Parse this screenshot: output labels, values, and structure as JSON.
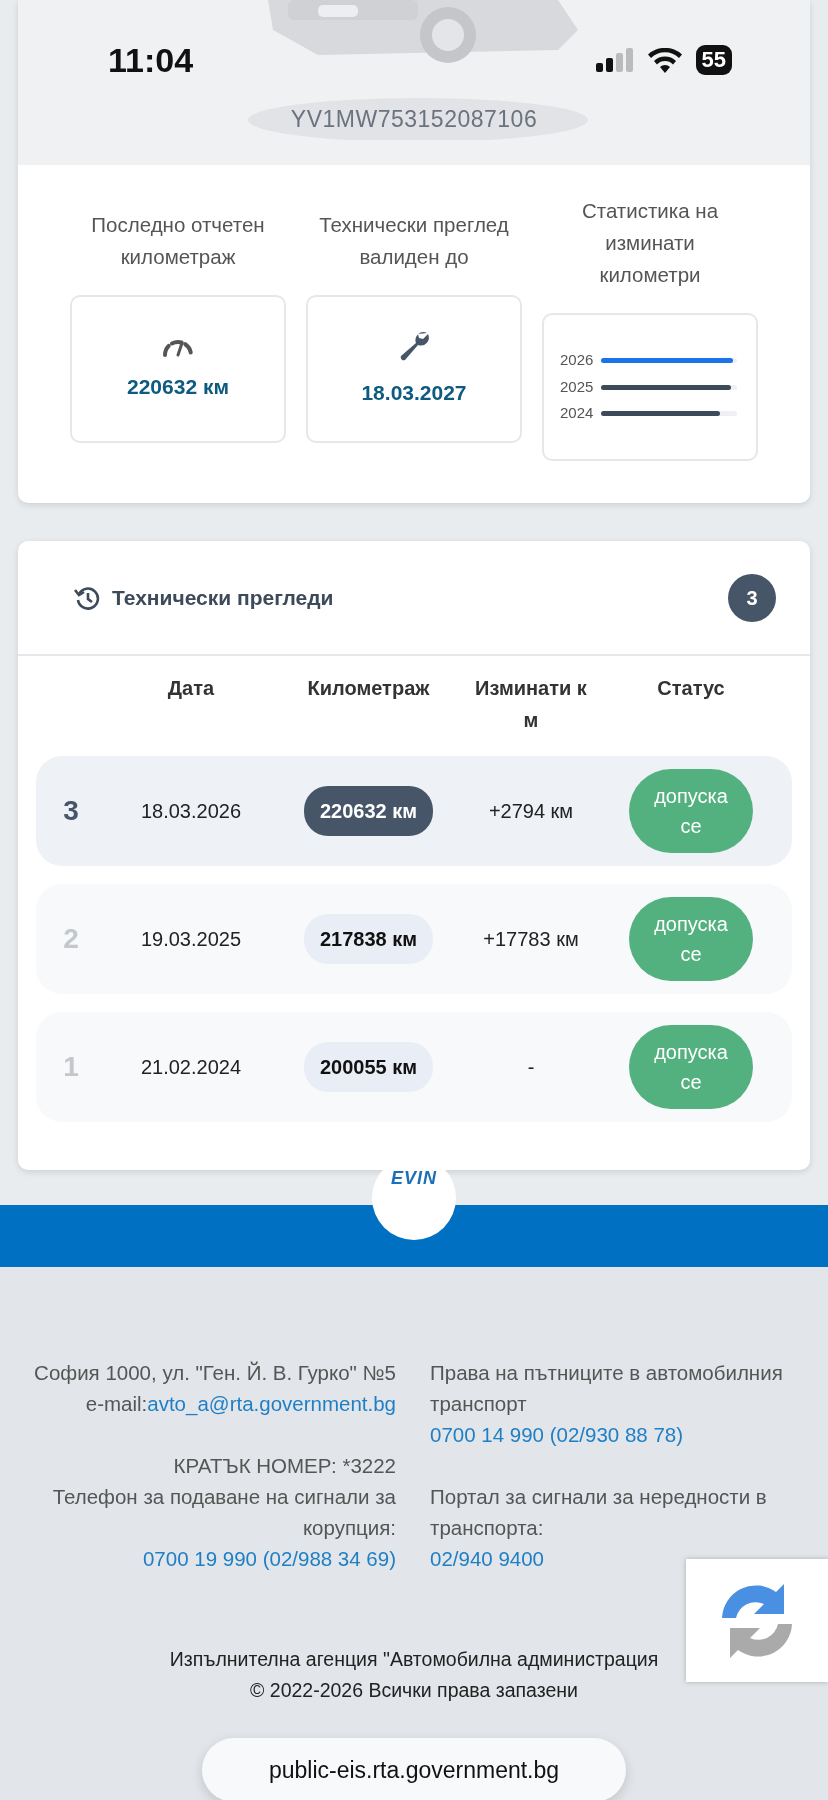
{
  "status_bar": {
    "time": "11:04",
    "battery": "55"
  },
  "vehicle": {
    "vin": "YV1MW753152087106"
  },
  "stats": [
    {
      "kind": "mileage",
      "label": "Последно отчетен километраж",
      "value": "220632 км"
    },
    {
      "kind": "inspection",
      "label": "Технически преглед валиден до",
      "value": "18.03.2027"
    },
    {
      "kind": "chart",
      "label": "Статистика на изминати километри",
      "years": [
        {
          "year": "2026",
          "color": "#1a73e8",
          "level": 0.97
        },
        {
          "year": "2025",
          "color": "#3d4a5a",
          "level": 0.95
        },
        {
          "year": "2024",
          "color": "#3d4a5a",
          "level": 0.87
        }
      ]
    }
  ],
  "inspections": {
    "title": "Технически прегледи",
    "count": "3",
    "columns": [
      "Дата",
      "Километраж",
      "Изминати км",
      "Статус"
    ],
    "rows": [
      {
        "index": "3",
        "date": "18.03.2026",
        "mileage": "220632 км",
        "diff": "+2794 км",
        "status": "допуска се",
        "selected": true
      },
      {
        "index": "2",
        "date": "19.03.2025",
        "mileage": "217838 км",
        "diff": "+17783 км",
        "status": "допуска се",
        "selected": false
      },
      {
        "index": "1",
        "date": "21.02.2024",
        "mileage": "200055 км",
        "diff": "-",
        "status": "допуска се",
        "selected": false
      }
    ]
  },
  "logo": "EVIN",
  "footer": {
    "left": [
      [
        {
          "kind": "text",
          "text": "София 1000, ул. \"Ген. Й. В. Гурко\" №5"
        },
        {
          "kind": "inline_link",
          "text": "e-mail:",
          "link": "avto_a@rta.government.bg"
        }
      ],
      [
        {
          "kind": "text",
          "text": "КРАТЪК НОМЕР: *3222"
        },
        {
          "kind": "link_below",
          "text": "Телефон за подаване на сигнали за корупция:",
          "link": "0700 19 990 (02/988 34 69)"
        }
      ]
    ],
    "right": [
      [
        {
          "kind": "link_below",
          "text": "Права на пътниците в автомобилния транспорт",
          "link": "0700 14 990 (02/930 88 78)"
        }
      ],
      [
        {
          "kind": "link_below",
          "text": "Портал за сигнали за нередности в транспорта:",
          "link": "02/940 9400"
        }
      ]
    ],
    "agency": "Изпълнителна агенция \"Автомобилна администрация",
    "copyright": "© 2022-2026 Всички права запазени"
  },
  "browser": {
    "url": "public-eis.rta.government.bg"
  }
}
